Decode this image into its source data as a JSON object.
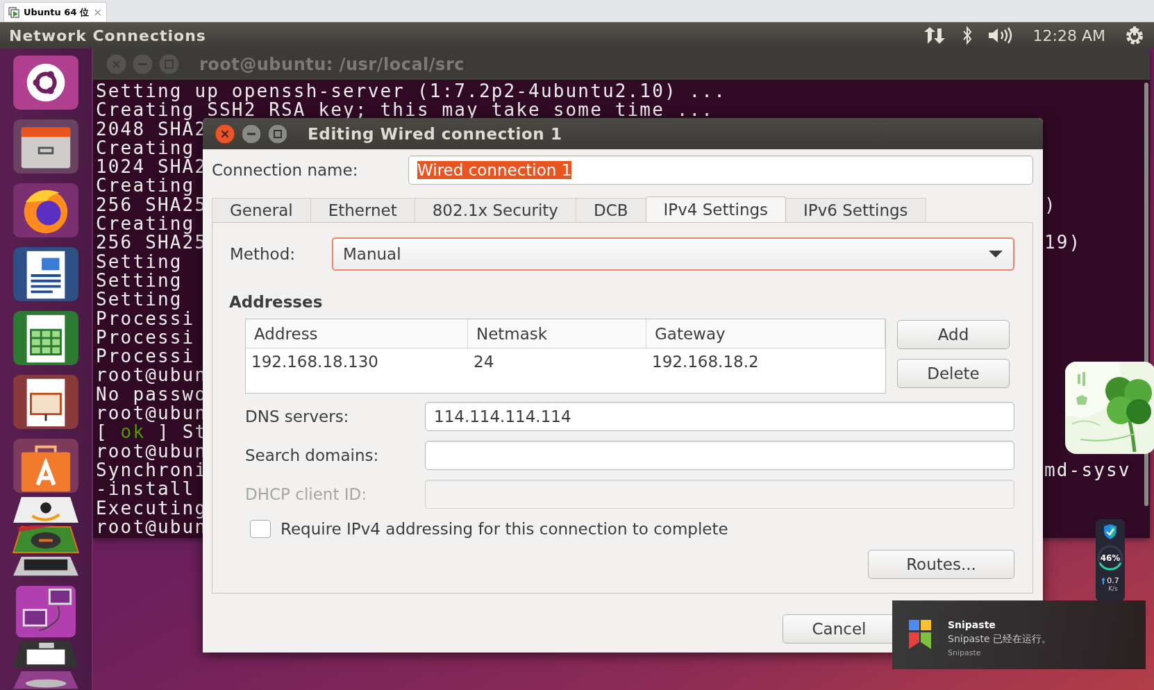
{
  "browser_tab": {
    "label": "Ubuntu 64 位",
    "close": "×",
    "selected": true
  },
  "top_panel": {
    "title": "Network Connections",
    "clock": "12:28 AM"
  },
  "launcher": {
    "items": [
      {
        "kind": "dash"
      },
      {
        "kind": "files"
      },
      {
        "kind": "firefox"
      },
      {
        "kind": "writer"
      },
      {
        "kind": "calc"
      },
      {
        "kind": "impress"
      },
      {
        "kind": "software"
      },
      {
        "kind": "amazon"
      },
      {
        "kind": "settings"
      },
      {
        "kind": "dark"
      },
      {
        "kind": "workspaces"
      },
      {
        "kind": "floppy"
      },
      {
        "kind": "trash"
      }
    ]
  },
  "terminal": {
    "title": "root@ubuntu: /usr/local/src",
    "lines": [
      {
        "text": "Setting up openssh-server (1:7.2p2-4ubuntu2.10) ..."
      },
      {
        "text": "Creating SSH2 RSA key; this may take some time ..."
      },
      {
        "text": "2048 SHA2"
      },
      {
        "text": "Creating"
      },
      {
        "text": "1024 SHA2"
      },
      {
        "text": "Creating"
      },
      {
        "text": "256 SHA25",
        "right": ")"
      },
      {
        "text": "Creating"
      },
      {
        "text": "256 SHA25",
        "right": "19)"
      },
      {
        "text": "Setting"
      },
      {
        "text": "Setting"
      },
      {
        "text": "Setting"
      },
      {
        "text": "Processi"
      },
      {
        "text": "Processi"
      },
      {
        "text": "Processi"
      },
      {
        "text": "root@ubun"
      },
      {
        "text": "No passwo"
      },
      {
        "text": "root@ubun"
      },
      {
        "segments": [
          {
            "text": "[ ",
            "kind": "plain"
          },
          {
            "text": "ok",
            "kind": "ok"
          },
          {
            "text": " ] St",
            "kind": "plain"
          }
        ]
      },
      {
        "text": "root@ubun"
      },
      {
        "text": "Synchroni",
        "right": "md-sysv"
      },
      {
        "text": "-install"
      },
      {
        "text": "Executing"
      },
      {
        "text": "root@ubun"
      }
    ]
  },
  "dialog": {
    "title": "Editing Wired connection 1",
    "connection_name": {
      "label": "Connection name:",
      "value": "Wired connection 1",
      "text_selected": true
    },
    "tabs": [
      {
        "label": "General",
        "selected": false
      },
      {
        "label": "Ethernet",
        "selected": false
      },
      {
        "label": "802.1x Security",
        "selected": false
      },
      {
        "label": "DCB",
        "selected": false
      },
      {
        "label": "IPv4 Settings",
        "selected": true
      },
      {
        "label": "IPv6 Settings",
        "selected": false
      }
    ],
    "method": {
      "label": "Method:",
      "value": "Manual",
      "focused": true
    },
    "addresses": {
      "heading": "Addresses",
      "columns": [
        "Address",
        "Netmask",
        "Gateway"
      ],
      "rows": [
        [
          "192.168.18.130",
          "24",
          "192.168.18.2"
        ]
      ],
      "buttons": [
        "Add",
        "Delete"
      ]
    },
    "fields": [
      {
        "label": "DNS servers:",
        "value": "114.114.114.114",
        "disabled": false
      },
      {
        "label": "Search domains:",
        "disabled": false
      },
      {
        "label": "DHCP client ID:",
        "disabled": true
      }
    ],
    "require_checkbox": {
      "label": "Require IPv4 addressing for this connection to complete",
      "checked": false
    },
    "routes_button": "Routes...",
    "cancel_button": "Cancel"
  },
  "widgets": {
    "monitor": {
      "percent": "46%",
      "speed": "0.7",
      "unit": "K/s"
    }
  },
  "notification": {
    "title": "Snipaste",
    "message": "Snipaste 已经在运行。",
    "source": "Snipaste"
  }
}
